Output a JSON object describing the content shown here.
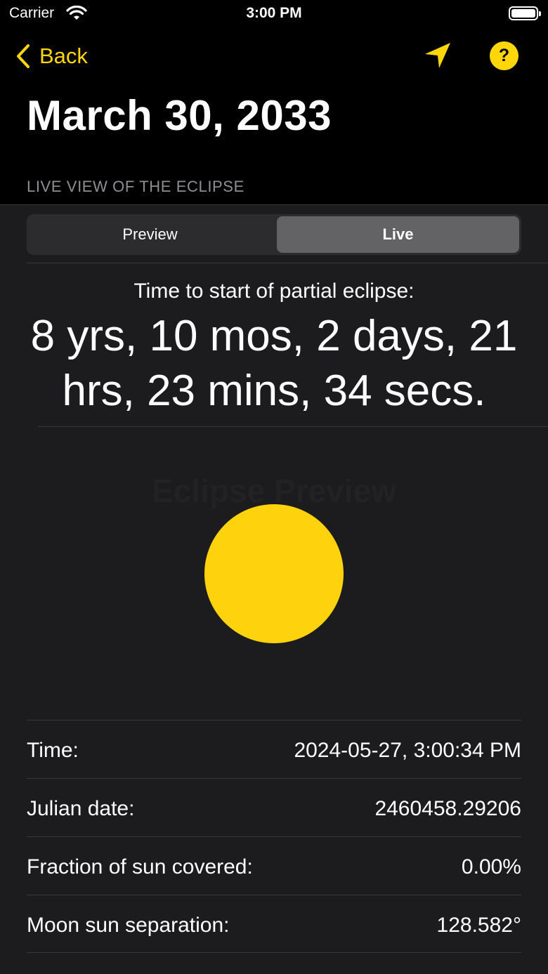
{
  "status_bar": {
    "carrier": "Carrier",
    "time": "3:00 PM"
  },
  "nav": {
    "back_label": "Back",
    "location_icon": "location-arrow-icon",
    "help_icon": "question-mark-circle-icon",
    "help_glyph": "?",
    "accent_color": "#fed60a"
  },
  "page": {
    "title": "March 30, 2033",
    "section_header": "LIVE VIEW OF THE ECLIPSE"
  },
  "segmented_control": {
    "options": [
      "Preview",
      "Live"
    ],
    "selected": "Live"
  },
  "countdown": {
    "label": "Time to start of partial eclipse:",
    "value": "8 yrs, 10 mos, 2 days, 21 hrs, 23 mins, 34 secs."
  },
  "eclipse_view": {
    "sun_color": "#fed20c",
    "faded_text": "Eclipse Preview"
  },
  "details": [
    {
      "label": "Time:",
      "value": "2024-05-27, 3:00:34 PM"
    },
    {
      "label": "Julian date:",
      "value": "2460458.29206"
    },
    {
      "label": "Fraction of sun covered:",
      "value": "0.00%"
    },
    {
      "label": "Moon sun separation:",
      "value": "128.582°"
    }
  ]
}
